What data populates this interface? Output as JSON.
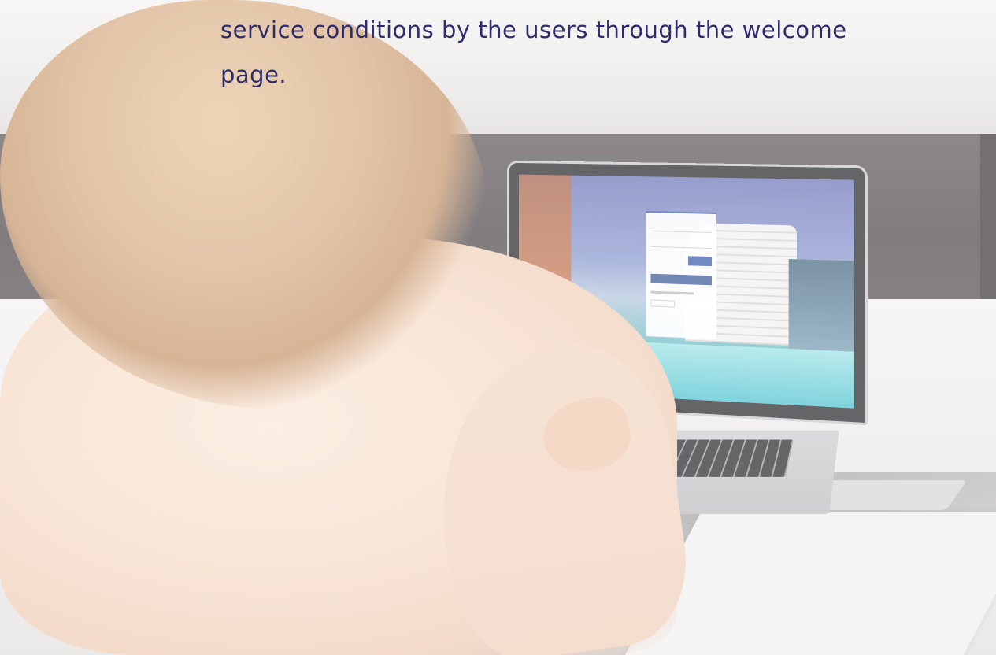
{
  "caption": {
    "text": "service conditions by the users through the welcome page."
  },
  "scene": {
    "laptop_screen": {
      "login_tabs": [
        "",
        "",
        ""
      ],
      "login_button": "",
      "facebook_button": ""
    }
  },
  "colors": {
    "caption_text": "#2c2b6b",
    "brand_blue": "#3b5ea9",
    "facebook_blue": "#3b5998"
  }
}
